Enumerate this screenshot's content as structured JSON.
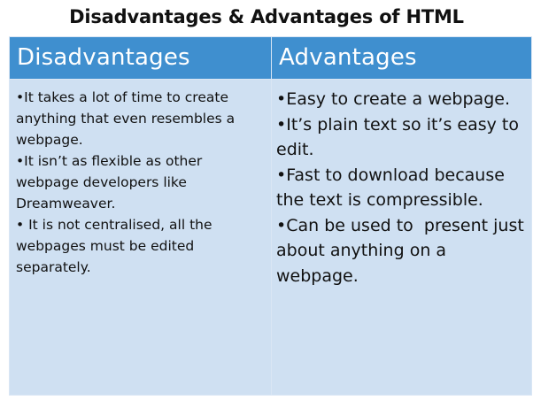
{
  "title": "Disadvantages & Advantages of HTML",
  "table": {
    "headers": {
      "disadvantages": "Disadvantages",
      "advantages": "Advantages"
    },
    "disadvantages": [
      "It takes a lot of time to create anything that even resembles a webpage.",
      "It isn’t as flexible as other webpage developers like Dreamweaver.",
      " It is not centralised, all the webpages must be edited separately."
    ],
    "advantages": [
      "Easy to create a webpage.",
      "It’s plain text so it’s easy to edit.",
      "Fast to download because the text is compressible.",
      "Can be used to  present just about anything on a webpage."
    ]
  },
  "bullet_symbol": "•",
  "colors": {
    "header_background": "#3f8fcf",
    "header_text": "#ffffff",
    "body_background": "#cfe0f2",
    "border": "#d9e6f4",
    "text": "#111111"
  }
}
